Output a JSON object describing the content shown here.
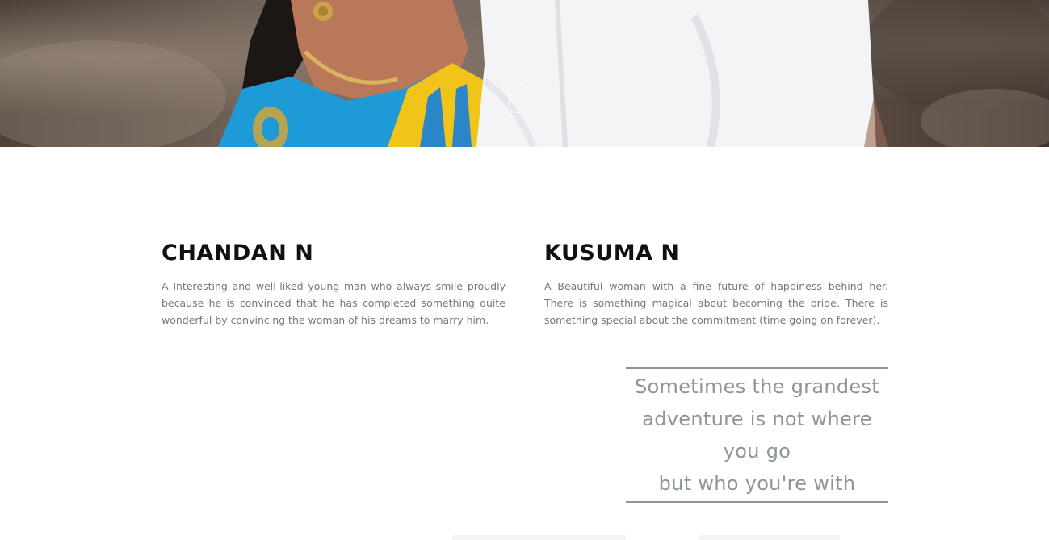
{
  "hero": {
    "scroll_indicator": "mouse-scroll-icon"
  },
  "groom": {
    "name": "CHANDAN N",
    "description": "A Interesting and well-liked young man who always smile proudly because he is convinced that he has completed something quite wonderful by convincing the woman of his dreams to marry him."
  },
  "bride": {
    "name": "KUSUMA N",
    "description": "A Beautiful woman with a fine future of happiness behind her. There is something magical about becoming the bride. There is something special about the commitment (time going on forever)."
  },
  "quote": {
    "lines": [
      "Sometimes the grandest",
      "adventure is not where you go",
      "but who you're with"
    ]
  },
  "colors": {
    "heading": "#111111",
    "body_text": "#777777",
    "quote": "#8e9596",
    "saree_blue": "#1e9ad6",
    "saree_yellow": "#f0c419",
    "shirt_white": "#f3f4f6"
  }
}
